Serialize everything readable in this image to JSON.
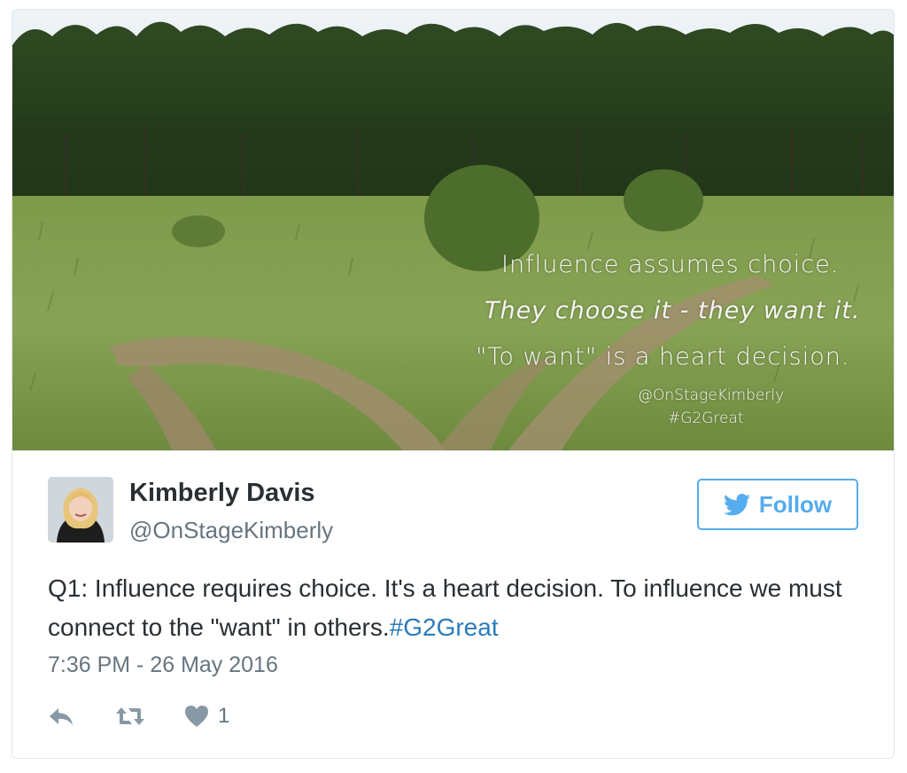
{
  "media": {
    "overlay_lines": [
      "Influence assumes choice.",
      "They choose it - they want it.",
      "\"To want\" is a heart decision.",
      "@OnStageKimberly",
      "#G2Great"
    ]
  },
  "author": {
    "name": "Kimberly Davis",
    "handle": "@OnStageKimberly",
    "avatar_icon": "profile-photo"
  },
  "follow_button": {
    "label": "Follow",
    "icon": "twitter-bird-icon",
    "color": "#55acee"
  },
  "tweet": {
    "text": "Q1: Influence requires choice. It's a heart decision. To influence we must connect to the \"want\" in others.",
    "hashtag": "#G2Great",
    "hashtag_color": "#2b7bb9",
    "timestamp": "7:36 PM - 26 May 2016"
  },
  "actions": {
    "reply_icon": "reply-icon",
    "retweet_icon": "retweet-icon",
    "like_icon": "heart-icon",
    "like_count": "1"
  }
}
